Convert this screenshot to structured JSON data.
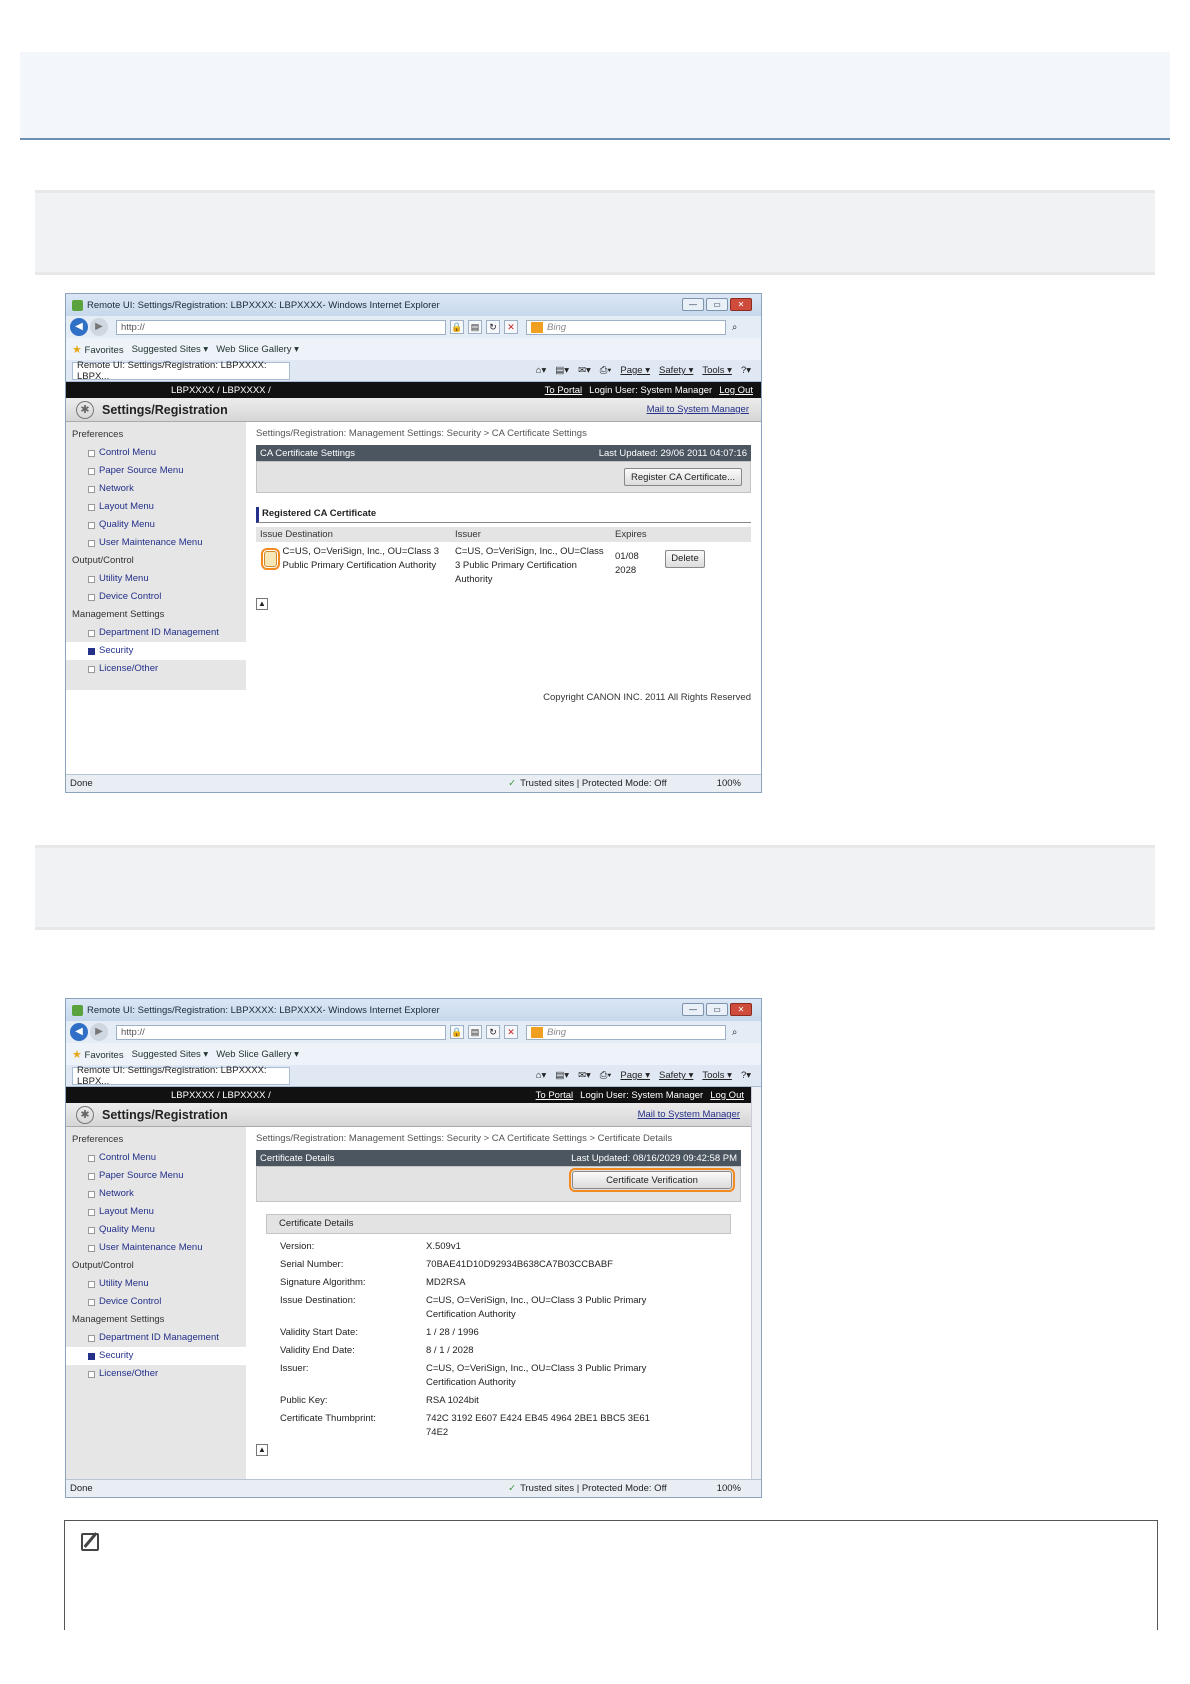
{
  "shot1": {
    "window_title": "Remote UI: Settings/Registration: LBPXXXX: LBPXXXX- Windows Internet Explorer",
    "address": "http://",
    "search_placeholder": "Bing",
    "favorites": "Favorites",
    "suggested_sites": "Suggested Sites ▾",
    "web_slice": "Web Slice Gallery ▾",
    "tab_label": "Remote UI: Settings/Registration: LBPXXXX: LBPX...",
    "cmd_page": "Page ▾",
    "cmd_safety": "Safety ▾",
    "cmd_tools": "Tools ▾",
    "dark_title": "LBPXXXX / LBPXXXX /",
    "to_portal": "To Portal",
    "login_user": "Login User: System Manager",
    "log_out": "Log Out",
    "app_title": "Settings/Registration",
    "mail_link": "Mail to System Manager",
    "breadcrumb": "Settings/Registration: Management Settings: Security > CA Certificate Settings",
    "panel_title": "CA Certificate Settings",
    "last_updated": "Last Updated: 29/06 2011 04:07:16",
    "register_button": "Register CA Certificate...",
    "registered_title": "Registered CA Certificate",
    "col_issue_dest": "Issue Destination",
    "col_issuer": "Issuer",
    "col_expires": "Expires",
    "row_issue_dest": "C=US, O=VeriSign, Inc., OU=Class 3 Public Primary Certification Authority",
    "row_issuer": "C=US, O=VeriSign, Inc., OU=Class 3 Public Primary Certification Authority",
    "row_expires": "01/08 2028",
    "delete_button": "Delete",
    "copyright": "Copyright CANON INC. 2011 All Rights Reserved",
    "status_done": "Done",
    "status_trusted": "Trusted sites | Protected Mode: Off",
    "zoom": "100%"
  },
  "sidebar": {
    "sec_preferences": "Preferences",
    "control_menu": "Control Menu",
    "paper_source_menu": "Paper Source Menu",
    "network": "Network",
    "layout_menu": "Layout Menu",
    "quality_menu": "Quality Menu",
    "user_maintenance_menu": "User Maintenance Menu",
    "sec_output": "Output/Control",
    "utility_menu": "Utility Menu",
    "device_control": "Device Control",
    "sec_management": "Management Settings",
    "department_id": "Department ID Management",
    "security": "Security",
    "license_other": "License/Other"
  },
  "shot2": {
    "breadcrumb": "Settings/Registration: Management Settings: Security > CA Certificate Settings > Certificate Details",
    "panel_title": "Certificate Details",
    "last_updated": "Last Updated: 08/16/2029 09:42:58 PM",
    "verify_button": "Certificate Verification",
    "details_title": "Certificate Details",
    "details": [
      {
        "k": "Version:",
        "v": "X.509v1"
      },
      {
        "k": "Serial Number:",
        "v": "70BAE41D10D92934B638CA7B03CCBABF"
      },
      {
        "k": "Signature Algorithm:",
        "v": "MD2RSA"
      },
      {
        "k": "Issue Destination:",
        "v": "C=US, O=VeriSign, Inc., OU=Class 3 Public Primary Certification Authority"
      },
      {
        "k": "Validity Start Date:",
        "v": "1 / 28 / 1996"
      },
      {
        "k": "Validity End Date:",
        "v": "8 / 1 / 2028"
      },
      {
        "k": "Issuer:",
        "v": "C=US, O=VeriSign, Inc., OU=Class 3 Public Primary Certification Authority"
      },
      {
        "k": "Public Key:",
        "v": "RSA 1024bit"
      },
      {
        "k": "Certificate Thumbprint:",
        "v": "742C 3192 E607 E424 EB45 4964 2BE1 BBC5 3E61 74E2"
      }
    ]
  },
  "colors": {
    "highlight": "#f28a1f",
    "link": "#24308a",
    "panel": "#4b5661"
  }
}
